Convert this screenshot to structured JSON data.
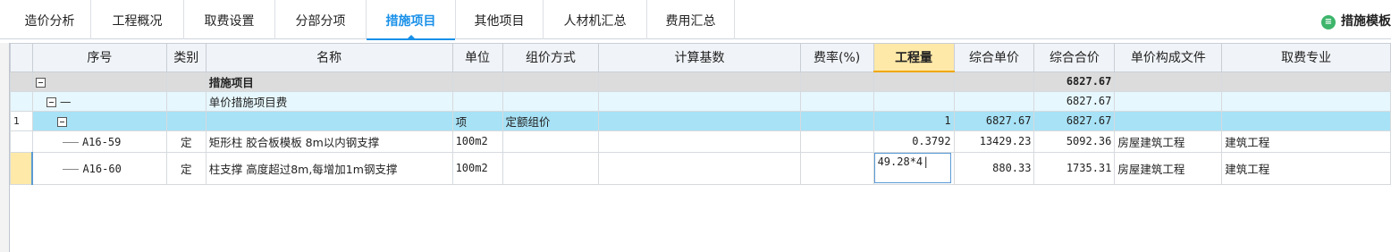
{
  "tabs": [
    {
      "label": "造价分析",
      "active": false
    },
    {
      "label": "工程概况",
      "active": false
    },
    {
      "label": "取费设置",
      "active": false
    },
    {
      "label": "分部分项",
      "active": false
    },
    {
      "label": "措施项目",
      "active": true
    },
    {
      "label": "其他项目",
      "active": false
    },
    {
      "label": "人材机汇总",
      "active": false
    },
    {
      "label": "费用汇总",
      "active": false
    }
  ],
  "right_tool": {
    "label": "措施模板",
    "icon": "template-icon"
  },
  "accent_color": "#1890e8",
  "columns": [
    "序号",
    "类别",
    "名称",
    "单位",
    "组价方式",
    "计算基数",
    "费率(%)",
    "工程量",
    "综合单价",
    "综合合价",
    "单价构成文件",
    "取费专业"
  ],
  "rows": [
    {
      "seq": "",
      "type": "",
      "name": "措施项目",
      "unit": "",
      "method": "",
      "base": "",
      "rate": "",
      "qty": "",
      "unit_price": "",
      "total": "6827.67",
      "file": "",
      "major": ""
    },
    {
      "seq": "—",
      "type": "",
      "name": "单价措施项目费",
      "unit": "",
      "method": "",
      "base": "",
      "rate": "",
      "qty": "",
      "unit_price": "",
      "total": "6827.67",
      "file": "",
      "major": ""
    },
    {
      "seq": "",
      "type": "",
      "name": "",
      "unit": "项",
      "method": "定额组价",
      "base": "",
      "rate": "",
      "qty": "1",
      "unit_price": "6827.67",
      "total": "6827.67",
      "file": "",
      "major": "",
      "rownum": "1"
    },
    {
      "seq": "A16-59",
      "type": "定",
      "name": "矩形柱 胶合板模板 8m以内钢支撑",
      "unit": "100m2",
      "method": "",
      "base": "",
      "rate": "",
      "qty": "0.3792",
      "unit_price": "13429.23",
      "total": "5092.36",
      "file": "房屋建筑工程",
      "major": "建筑工程"
    },
    {
      "seq": "A16-60",
      "type": "定",
      "name": "柱支撑 高度超过8m,每增加1m钢支撑",
      "unit": "100m2",
      "method": "",
      "base": "",
      "rate": "",
      "qty": "49.28*4|",
      "unit_price": "880.33",
      "total": "1735.31",
      "file": "房屋建筑工程",
      "major": "建筑工程"
    }
  ]
}
